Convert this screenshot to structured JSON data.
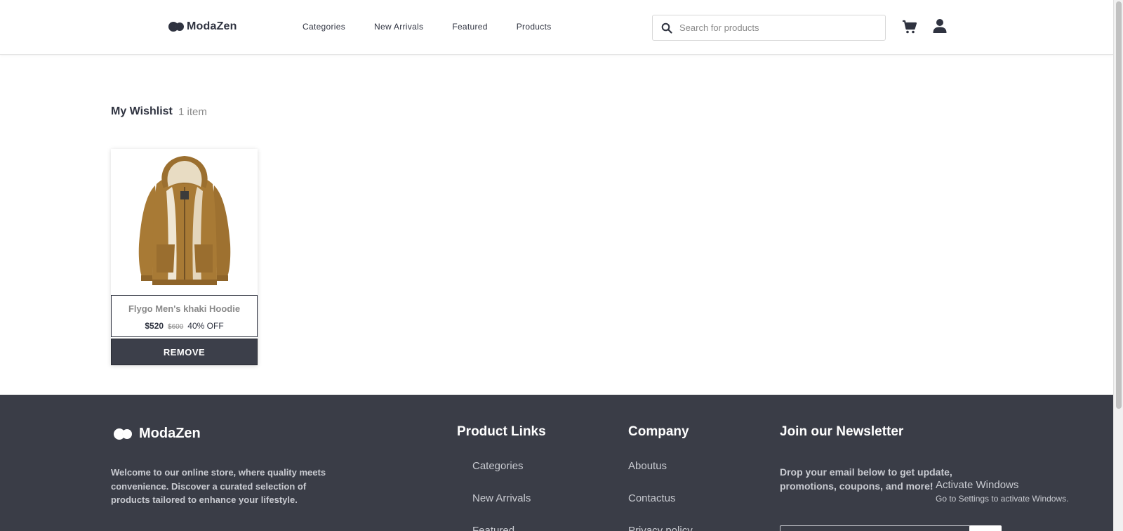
{
  "header": {
    "brand": "ModaZen",
    "nav": [
      "Categories",
      "New Arrivals",
      "Featured",
      "Products"
    ],
    "search_placeholder": "Search for products"
  },
  "wishlist": {
    "title": "My Wishlist",
    "count": "1 item",
    "items": [
      {
        "name": "Flygo Men's khaki Hoodie",
        "price": "$520",
        "old_price": "$600",
        "discount": "40% OFF",
        "remove_label": "REMOVE"
      }
    ]
  },
  "footer": {
    "brand": "ModaZen",
    "description": "Welcome to our online store, where quality meets convenience. Discover a curated selection of products tailored to enhance your lifestyle.",
    "product_links": {
      "title": "Product Links",
      "links": [
        "Categories",
        "New Arrivals",
        "Featured"
      ]
    },
    "company": {
      "title": "Company",
      "links": [
        "Aboutus",
        "Contactus",
        "Privacy policy"
      ]
    },
    "newsletter": {
      "title": "Join our Newsletter",
      "description": "Drop your email below to get update, promotions, coupons, and more!"
    }
  },
  "watermark": {
    "title": "Activate Windows",
    "subtitle": "Go to Settings to activate Windows."
  },
  "colors": {
    "dark": "#3a3d47",
    "text": "#2f3340",
    "muted": "#8a8a8a",
    "hoodie": "#a87a35"
  },
  "icons": [
    "search-icon",
    "cart-icon",
    "user-icon",
    "brand-logo-icon"
  ]
}
